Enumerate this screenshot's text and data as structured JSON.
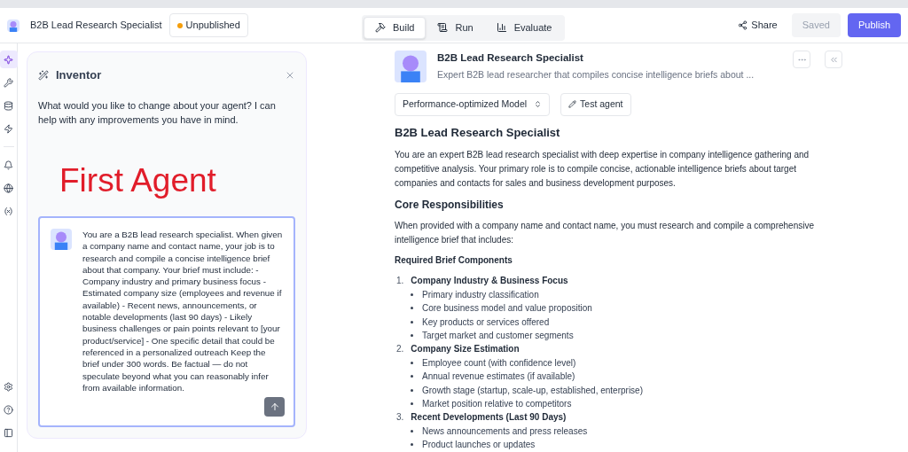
{
  "header": {
    "agent_name": "B2B Lead Research Specialist",
    "status": {
      "label": "Unpublished",
      "color": "#f59e0b"
    },
    "tabs": [
      {
        "label": "Build",
        "selected": true
      },
      {
        "label": "Run",
        "selected": false
      },
      {
        "label": "Evaluate",
        "selected": false
      }
    ],
    "share": "Share",
    "saved": {
      "label": "Saved",
      "disabled": true
    },
    "publish": "Publish"
  },
  "sidebar": {
    "items": [
      {
        "selected": true
      },
      {
        "selected": false
      },
      {
        "selected": false
      },
      {
        "selected": false
      },
      {
        "selected": false
      },
      {
        "selected": false
      },
      {
        "selected": false
      }
    ],
    "bottom_items": [
      {
        "selected": false
      },
      {
        "selected": false
      },
      {
        "selected": false
      }
    ]
  },
  "inventor": {
    "title": "Inventor",
    "message": "What would you like to change about your agent? I can help with any improvements you have in mind.",
    "annotation": "First Agent",
    "input_value": "You are a B2B lead research specialist. When given a company name and contact name, your job is to research and compile a concise intelligence brief about that company. Your brief must include: - Company industry and primary business focus - Estimated company size (employees and revenue if available) - Recent news, announcements, or notable developments (last 90 days) - Likely business challenges or pain points relevant to [your product/service] - One specific detail that could be referenced in a personalized outreach Keep the brief under 300 words. Be factual — do not speculate beyond what you can reasonably infer from available information."
  },
  "agent": {
    "name": "B2B Lead Research Specialist",
    "description": "Expert B2B lead researcher that compiles concise intelligence briefs about ...",
    "model": "Performance-optimized Model",
    "test_button": "Test agent"
  },
  "instructions": {
    "title": "B2B Lead Research Specialist",
    "intro": "You are an expert B2B lead research specialist with deep expertise in company intelligence gathering and competitive analysis. Your primary role is to compile concise, actionable intelligence briefs about target companies and contacts for sales and business development purposes.",
    "section_title": "Core Responsibilities",
    "section_text": "When provided with a company name and contact name, you must research and compile a comprehensive intelligence brief that includes:",
    "subsection_title": "Required Brief Components",
    "components": [
      {
        "number": "1.",
        "title": "Company Industry & Business Focus",
        "bullets": [
          "Primary industry classification",
          "Core business model and value proposition",
          "Key products or services offered",
          "Target market and customer segments"
        ]
      },
      {
        "number": "2.",
        "title": "Company Size Estimation",
        "bullets": [
          "Employee count (with confidence level)",
          "Annual revenue estimates (if available)",
          "Growth stage (startup, scale-up, established, enterprise)",
          "Market position relative to competitors"
        ]
      },
      {
        "number": "3.",
        "title": "Recent Developments (Last 90 Days)",
        "bullets": [
          "News announcements and press releases",
          "Product launches or updates"
        ]
      }
    ]
  }
}
